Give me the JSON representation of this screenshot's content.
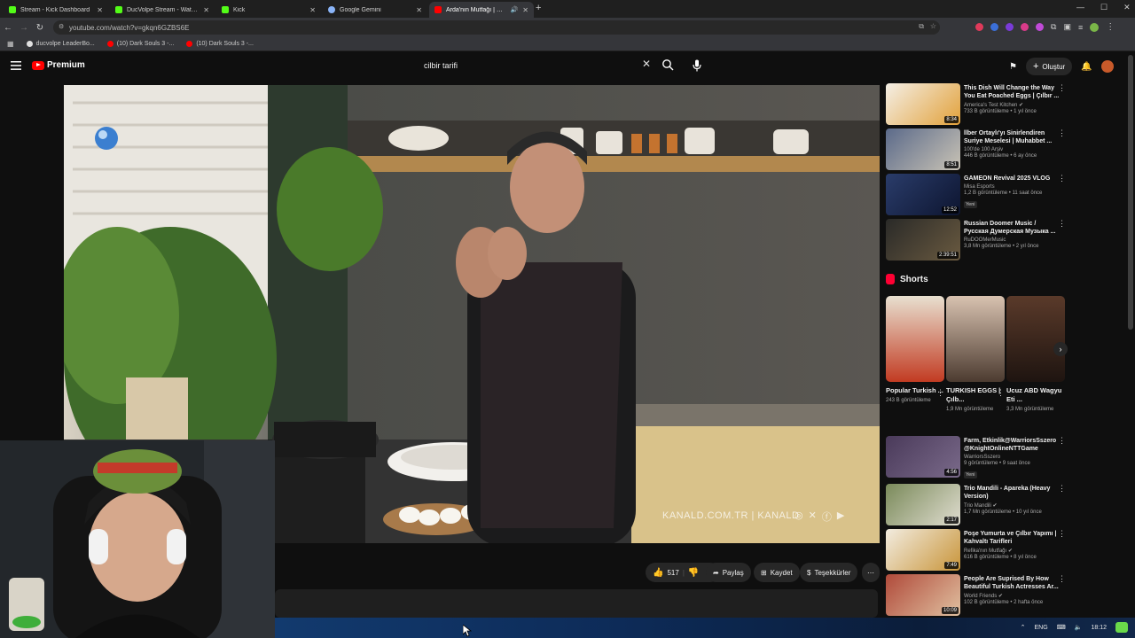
{
  "browser": {
    "tabs": [
      {
        "title": "Stream - Kick Dashboard",
        "color": "#53fc18"
      },
      {
        "title": "DucVolpe Stream - Watch Live",
        "color": "#53fc18"
      },
      {
        "title": "Kick",
        "color": "#53fc18"
      },
      {
        "title": "Google Gemini",
        "color": "#8ab4f8"
      },
      {
        "title": "Arda'nın Mutfağı | Çılbır Tarifi",
        "color": "#ff0000"
      }
    ],
    "url": "youtube.com/watch?v=gkqn6GZBS6E",
    "bookmarks": [
      {
        "label": "ducvolpe LeaderBo...",
        "color": "#e0e0e0"
      },
      {
        "label": "(10) Dark Souls 3 -...",
        "color": "#ff0000"
      },
      {
        "label": "(10) Dark Souls 3 -...",
        "color": "#ff0000"
      }
    ]
  },
  "youtube": {
    "logo_text": "Premium",
    "search_value": "cilbir tarifi",
    "create_label": "Oluştur"
  },
  "video": {
    "watermark": "KANALD.COM.TR | KANALD",
    "likes": "517",
    "share_label": "Paylaş",
    "save_label": "Kaydet",
    "thanks_label": "Teşekkürler"
  },
  "sidebar": {
    "recs": [
      {
        "title": "This Dish Will Change the Way You Eat Poached Eggs | Çılbır ...",
        "channel": "America's Test Kitchen ✔",
        "meta": "733 B görüntüleme • 1 yıl önce",
        "duration": "8:34",
        "colors": [
          "#f4efe6",
          "#e2a13a"
        ]
      },
      {
        "title": "İlber Ortaylı'yı Sinirlendiren Suriye Meselesi | Muhabbet ...",
        "channel": "100'de 100 Arşiv",
        "meta": "446 B görüntüleme • 6 ay önce",
        "duration": "8:51",
        "colors": [
          "#5b6a8a",
          "#c9c3b5"
        ]
      },
      {
        "title": "GAMEON Revival 2025 VLOG",
        "channel": "Misa Esports",
        "meta": "1,2 B görüntüleme • 11 saat önce",
        "badge": "Yeni",
        "duration": "12:52",
        "colors": [
          "#2a3c6a",
          "#0d1530"
        ]
      },
      {
        "title": "Russian Doomer Music / Русская Думерская Музыка ...",
        "channel": "RuDOOMerMusic",
        "meta": "3,8 Mn görüntüleme • 2 yıl önce",
        "duration": "2:39:51",
        "colors": [
          "#2a2a28",
          "#6a5a40"
        ]
      }
    ],
    "shorts_heading": "Shorts",
    "shorts": [
      {
        "title": "Popular Turkish ...",
        "views": "243 B görüntüleme",
        "colors": [
          "#e8e0d0",
          "#c23b22"
        ]
      },
      {
        "title": "TURKISH EGGS | Çılb...",
        "views": "1,9 Mn görüntüleme",
        "colors": [
          "#d8c2b0",
          "#4c3b30"
        ]
      },
      {
        "title": "Ucuz ABD Wagyu Eti ...",
        "views": "3,3 Mn görüntüleme",
        "colors": [
          "#5a3a2a",
          "#1e1410"
        ]
      }
    ],
    "recs2": [
      {
        "title": "Farm, Etkinlik@WarriorsSszero @KnightOnlineNTTGame",
        "channel": "WarriorsSszero",
        "meta": "9 görüntüleme • 9 saat önce",
        "badge": "Yeni",
        "duration": "4:56",
        "colors": [
          "#4a3a5a",
          "#7a6a8a"
        ]
      },
      {
        "title": "Trio Mandili - Apareka (Heavy Version)",
        "channel": "Trio Mandili ✔",
        "meta": "1,7 Mn görüntüleme • 10 yıl önce",
        "duration": "2:17",
        "colors": [
          "#7a8a5a",
          "#e0ddd0"
        ]
      },
      {
        "title": "Poşe Yumurta ve Çılbır Yapımı | Kahvaltı Tarifleri",
        "channel": "Refika'nın Mutfağı ✔",
        "meta": "616 B görüntüleme • 8 yıl önce",
        "duration": "7:49",
        "colors": [
          "#f2ece0",
          "#c9953a"
        ]
      },
      {
        "title": "People Are Suprised By How Beautiful Turkish Actresses Ar...",
        "channel": "World Friends ✔",
        "meta": "102 B görüntüleme • 2 hafta önce",
        "duration": "10:09",
        "colors": [
          "#b04a3a",
          "#e0c0a0"
        ]
      }
    ]
  },
  "taskbar": {
    "lang": "ENG",
    "time": "18:12"
  }
}
